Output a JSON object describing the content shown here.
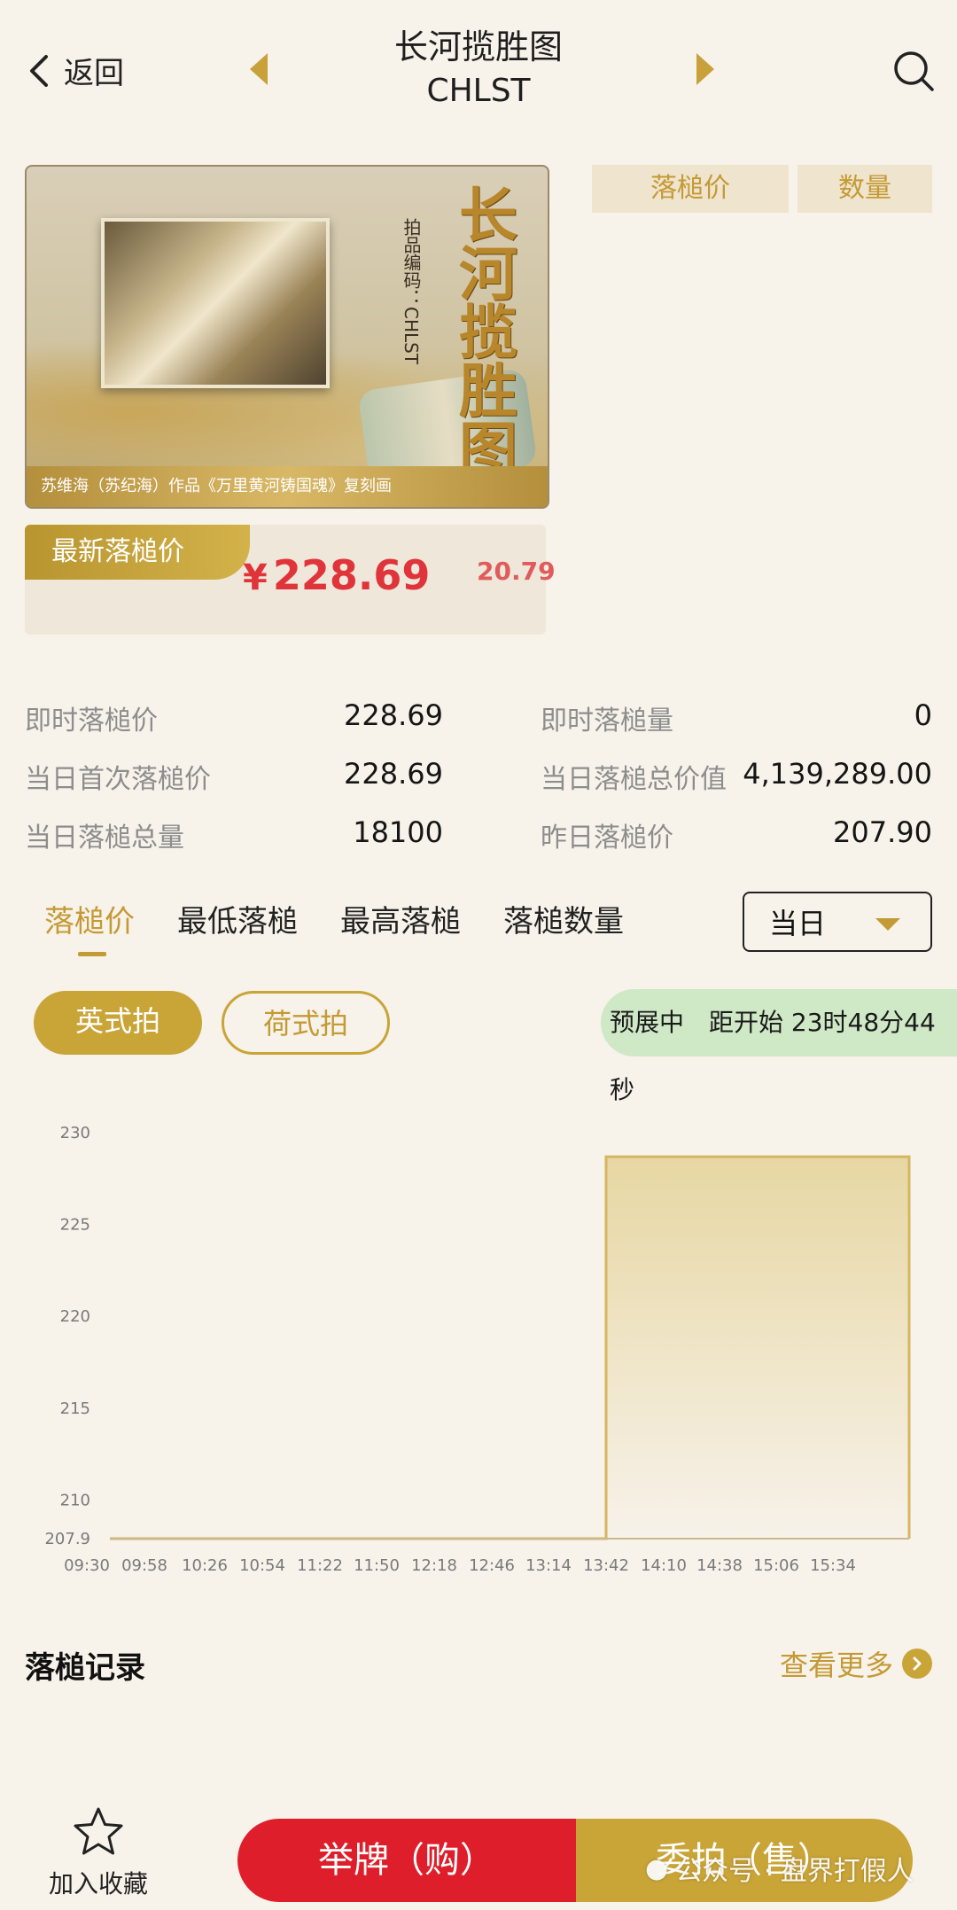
{
  "header": {
    "back_label": "返回",
    "title": "长河揽胜图",
    "subtitle": "CHLST"
  },
  "hero": {
    "calligraphy": "长河揽胜图",
    "code_text": "拍品编码：CHLST",
    "caption": "苏维海（苏纪海）作品《万里黄河铸国魂》复刻画"
  },
  "columns": {
    "price": "落槌价",
    "quantity": "数量"
  },
  "price_card": {
    "badge": "最新落槌价",
    "currency": "¥",
    "price": "228.69",
    "change": "20.79"
  },
  "stats": [
    {
      "label_left": "即时落槌价",
      "value_left": "228.69",
      "label_right": "即时落槌量",
      "value_right": "0"
    },
    {
      "label_left": "当日首次落槌价",
      "value_left": "228.69",
      "label_right": "当日落槌总价值",
      "value_right": "4,139,289.00"
    },
    {
      "label_left": "当日落槌总量",
      "value_left": "18100",
      "label_right": "昨日落槌价",
      "value_right": "207.90"
    }
  ],
  "tabs": [
    "落槌价",
    "最低落槌",
    "最高落槌",
    "落槌数量"
  ],
  "dropdown": {
    "selected": "当日"
  },
  "auction_types": {
    "english": "英式拍",
    "dutch": "荷式拍"
  },
  "status": "预展中　距开始 23时48分44秒",
  "chart_data": {
    "type": "area",
    "x": [
      "09:30",
      "09:58",
      "10:26",
      "10:54",
      "11:22",
      "11:50",
      "12:18",
      "12:46",
      "13:14",
      "13:42",
      "14:10",
      "14:38",
      "15:06",
      "15:34"
    ],
    "series": [
      {
        "values": [
          207.9,
          207.9,
          207.9,
          207.9,
          207.9,
          207.9,
          207.9,
          207.9,
          207.9,
          228.69,
          228.69,
          228.69,
          228.69,
          228.69
        ]
      }
    ],
    "y_ticks": [
      207.9,
      210,
      215,
      220,
      225,
      230
    ],
    "ylim": [
      207.9,
      230
    ],
    "step_at": "13:42",
    "grid": false,
    "colors": {
      "line": "#d4b75e",
      "fill_top": "#e7d7a3",
      "fill_bottom": "#f7f2ea"
    }
  },
  "records": {
    "title": "落槌记录",
    "more": "查看更多"
  },
  "bottom": {
    "favorite": "加入收藏",
    "buy": "举牌（购）",
    "sell": "委拍（售）",
    "watermark": "公众号 · 盘界打假人"
  },
  "colors": {
    "gold": "#c9a437",
    "red": "#de1f2b",
    "background": "#f7f2ea",
    "status_bg": "#cfe8c6"
  }
}
